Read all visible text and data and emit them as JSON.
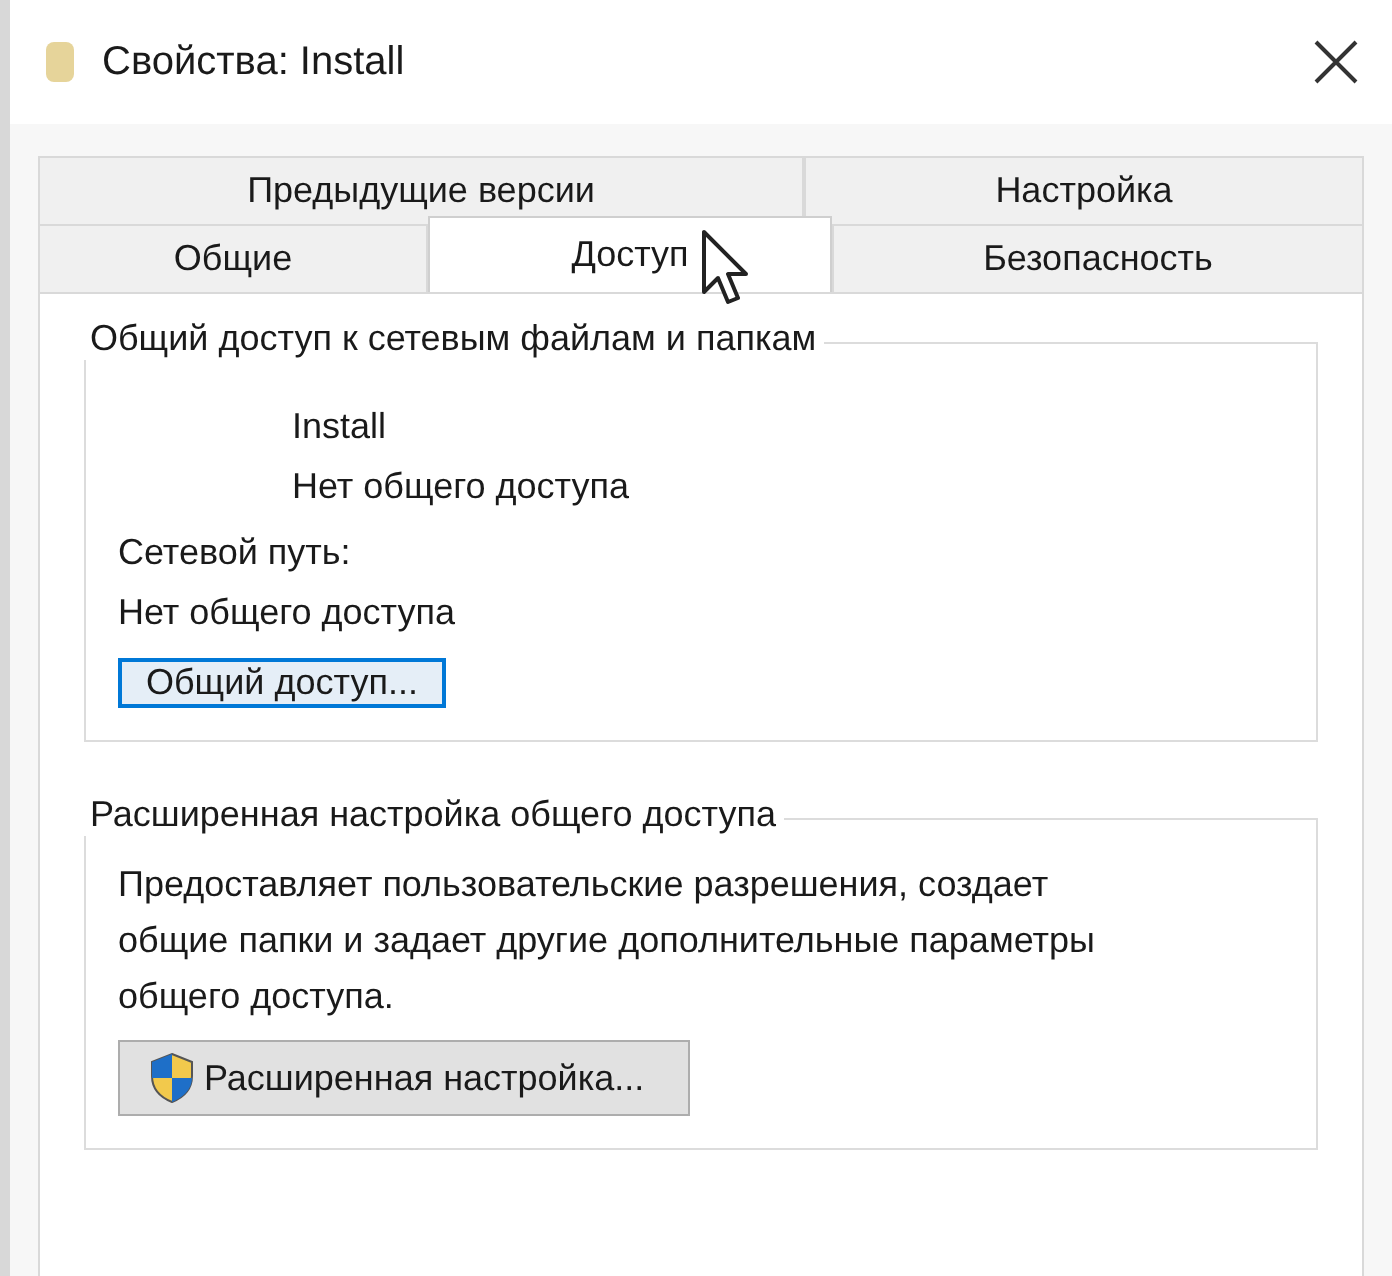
{
  "window": {
    "title": "Свойства: Install"
  },
  "tab_rows": [
    {
      "tabs": [
        {
          "label": "Предыдущие версии",
          "selected": false
        },
        {
          "label": "Настройка",
          "selected": false
        }
      ]
    },
    {
      "tabs": [
        {
          "label": "Общие",
          "selected": false
        },
        {
          "label": "Доступ",
          "selected": true
        },
        {
          "label": "Безопасность",
          "selected": false
        }
      ]
    }
  ],
  "groups": [
    {
      "title": "Общий доступ к сетевым файлам и папкам",
      "kind": "sharing",
      "folder_name": "Install",
      "folder_status": "Нет общего доступа",
      "path_label": "Сетевой путь:",
      "path_value": "Нет общего доступа",
      "button": {
        "label": "Общий доступ...",
        "focused": true,
        "kind": "plain"
      }
    },
    {
      "title": "Расширенная настройка общего доступа",
      "kind": "advanced",
      "description": "Предоставляет пользовательские разрешения, создает общие папки и задает другие дополнительные параметры общего доступа.",
      "button": {
        "label": "Расширенная настройка...",
        "focused": false,
        "kind": "shield"
      }
    }
  ]
}
